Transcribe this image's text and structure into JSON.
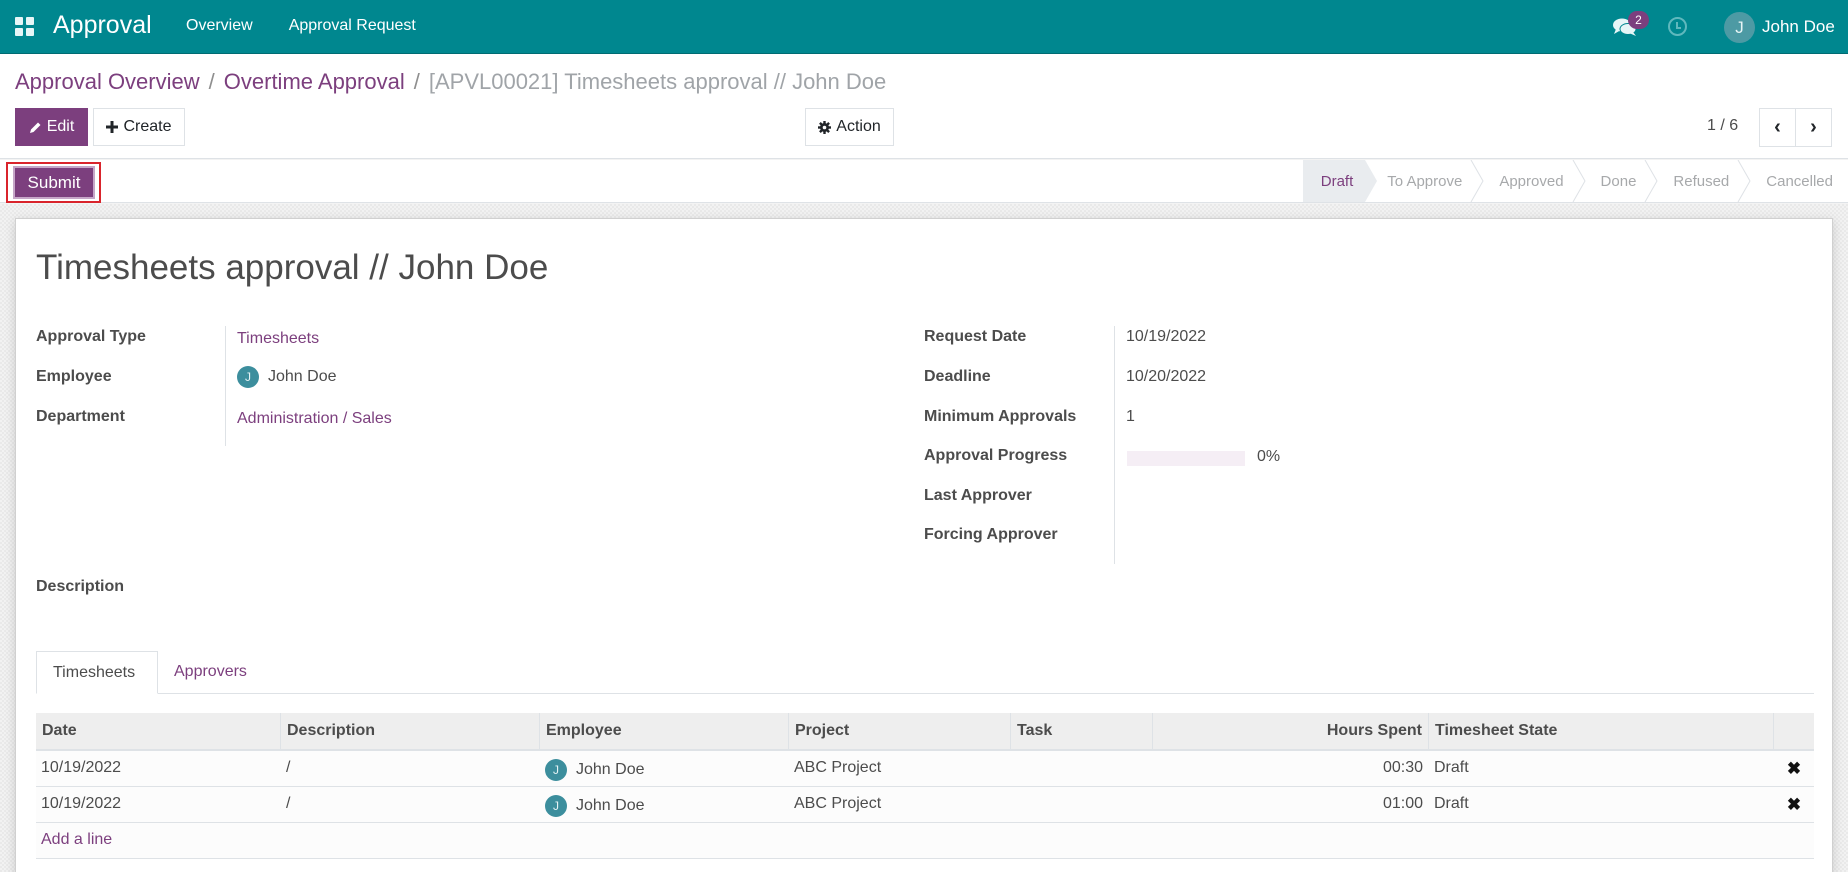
{
  "navbar": {
    "app_name": "Approval",
    "menu": [
      "Overview",
      "Approval Request"
    ],
    "messages_badge": "2",
    "user_initial": "J",
    "user_name": "John Doe"
  },
  "breadcrumb": {
    "items": [
      "Approval Overview",
      "Overtime Approval"
    ],
    "current": "[APVL00021] Timesheets approval // John Doe",
    "separator": "/"
  },
  "toolbar": {
    "edit_label": "Edit",
    "create_label": "Create",
    "action_label": "Action",
    "pager": "1 / 6"
  },
  "statusbar": {
    "submit_label": "Submit",
    "stages": [
      "Draft",
      "To Approve",
      "Approved",
      "Done",
      "Refused",
      "Cancelled"
    ],
    "active_stage": "Draft"
  },
  "record": {
    "title": "Timesheets approval // John Doe",
    "left_fields": {
      "approval_type_label": "Approval Type",
      "approval_type": "Timesheets",
      "employee_label": "Employee",
      "employee_initial": "J",
      "employee": "John Doe",
      "department_label": "Department",
      "department": "Administration / Sales"
    },
    "right_fields": {
      "request_date_label": "Request Date",
      "request_date": "10/19/2022",
      "deadline_label": "Deadline",
      "deadline": "10/20/2022",
      "min_approvals_label": "Minimum Approvals",
      "min_approvals": "1",
      "progress_label": "Approval Progress",
      "progress_percent": 0,
      "progress_text": "0%",
      "last_approver_label": "Last Approver",
      "forcing_approver_label": "Forcing Approver"
    },
    "description_label": "Description"
  },
  "tabs": [
    "Timesheets",
    "Approvers"
  ],
  "timesheets": {
    "columns": [
      "Date",
      "Description",
      "Employee",
      "Project",
      "Task",
      "Hours Spent",
      "Timesheet State"
    ],
    "rows": [
      {
        "date": "10/19/2022",
        "description": "/",
        "employee_initial": "J",
        "employee": "John Doe",
        "project": "ABC Project",
        "task": "",
        "hours": "00:30",
        "state": "Draft"
      },
      {
        "date": "10/19/2022",
        "description": "/",
        "employee_initial": "J",
        "employee": "John Doe",
        "project": "ABC Project",
        "task": "",
        "hours": "01:00",
        "state": "Draft"
      }
    ],
    "add_line_label": "Add a line"
  },
  "colors": {
    "brand": "#00878f",
    "accent": "#7c3f7e",
    "highlight": "#d9242c"
  }
}
